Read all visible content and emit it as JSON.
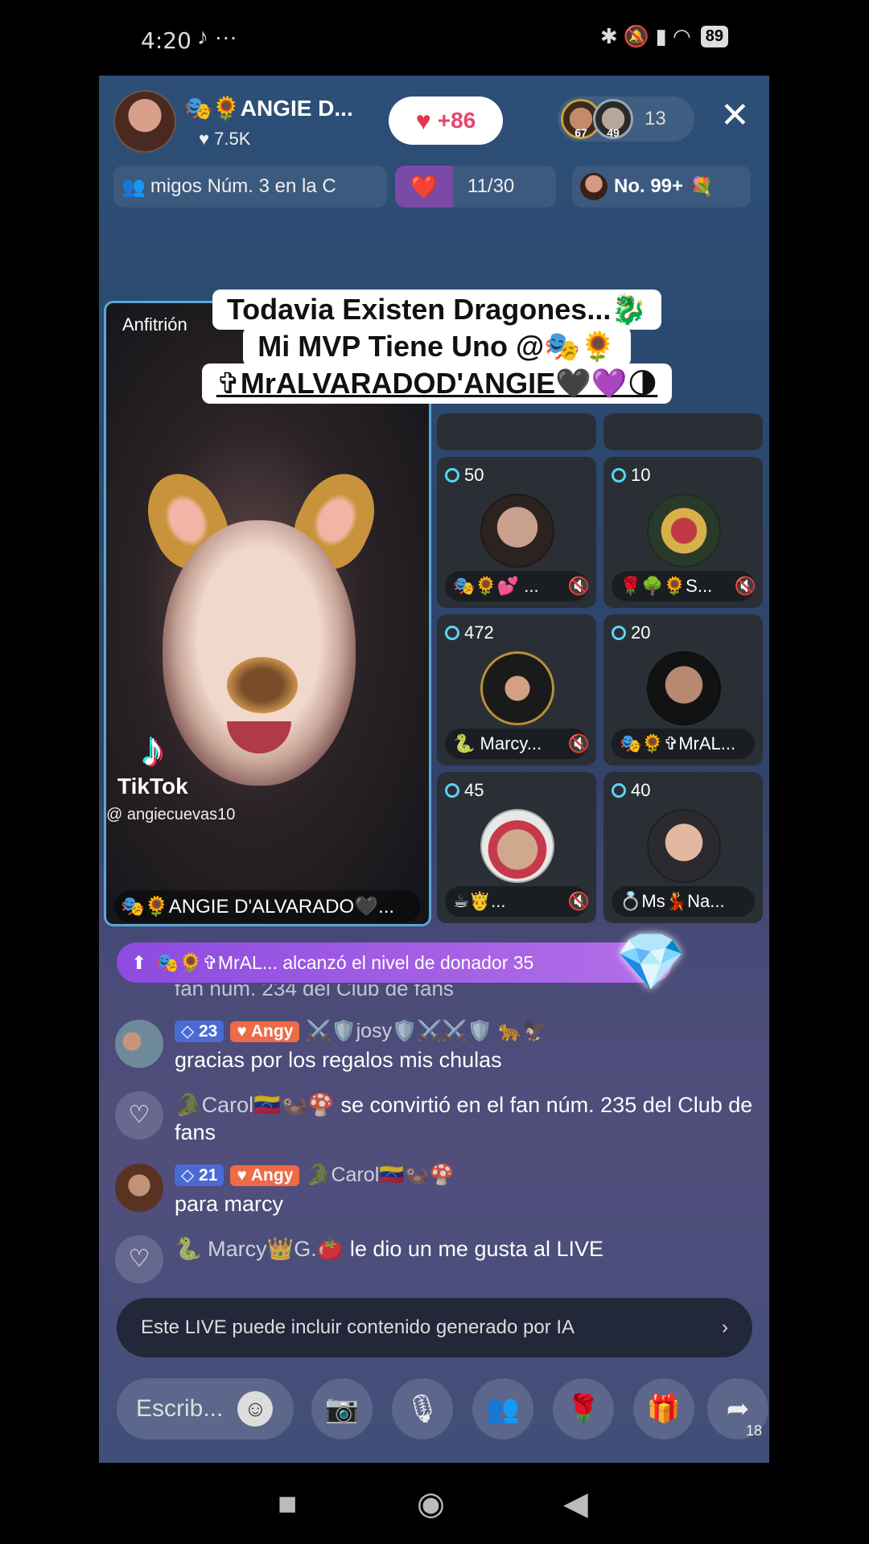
{
  "status_bar": {
    "time": "4:20",
    "left_icons": "♪ ···",
    "right_icons": "✱ 🔕 ▮ ◠",
    "battery": "89"
  },
  "host": {
    "name": "🎭🌻ANGIE D...",
    "likes": "♥ 7.5K",
    "like_pill": "+86"
  },
  "viewers": {
    "av1": "67",
    "av2": "49",
    "count": "13"
  },
  "chips": {
    "rank": "migos   Núm. 3 en la C",
    "progress": "11/30",
    "ranking": "No. 99+"
  },
  "caption": {
    "line1": "Todavia Existen Dragones...🐉",
    "line2": "Mi MVP Tiene Uno @🎭🌻",
    "line3": "✞MrALVARADOD'ANGIE🖤💜🌗"
  },
  "host_video": {
    "label": "Anfitrión",
    "brand": "TikTok",
    "handle": "@ angiecuevas10",
    "name_bar": "🎭🌻ANGIE D'ALVARADO🖤..."
  },
  "guests": [
    {
      "score": "50",
      "name": "🎭🌻💕 ...",
      "color": "#30261f"
    },
    {
      "score": "10",
      "name": "🌹🌳🌻S...",
      "color": "#1f2420"
    },
    {
      "score": "472",
      "name": "🐍 Marcy...",
      "color": "#2a2a2f"
    },
    {
      "score": "20",
      "name": "🎭🌻✞MrAL...",
      "color": "#23272e"
    },
    {
      "score": "45",
      "name": "☕🤴...",
      "color": "#3a3f46"
    },
    {
      "score": "40",
      "name": "💍Ms💃Na...",
      "color": "#3b3e47"
    }
  ],
  "banner": {
    "text": "🎭🌻✞MrAL... alcanzó el nivel de donador 35"
  },
  "chat": {
    "fade": "fan núm. 234 del Club de fans",
    "messages": [
      {
        "level": "23",
        "fan": "Angy",
        "user": "⚔️🛡️josy🛡️⚔️⚔️🛡️ 🐆🦅",
        "text": "gracias por los regalos mis chulas"
      },
      {
        "system_user": "🐊Carol🇻🇪🦦🍄",
        "system_text": " se convirtió en el fan núm. 235 del Club de fans"
      },
      {
        "level": "21",
        "fan": "Angy",
        "user": "🐊Carol🇻🇪🦦🍄",
        "text": "para marcy"
      },
      {
        "system_user": "🐍 Marcy👑G.🍅",
        "system_text": " le dio un me gusta al LIVE"
      }
    ]
  },
  "ai_note": "Este LIVE puede incluir contenido generado por IA",
  "bottom": {
    "placeholder": "Escrib...",
    "share_count": "18"
  }
}
